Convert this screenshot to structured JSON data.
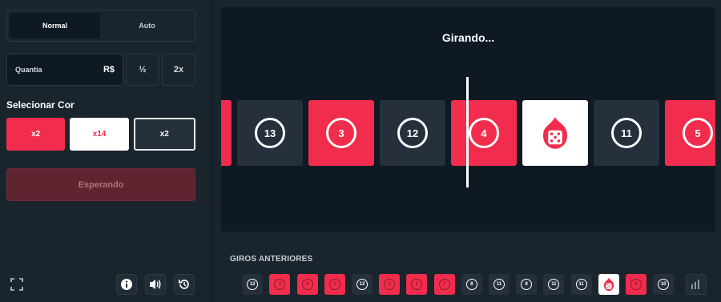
{
  "mode": {
    "tabs": [
      "Normal",
      "Auto"
    ],
    "active": "Normal"
  },
  "bet": {
    "amount_label": "Quantia",
    "currency": "R$",
    "half_label": "½",
    "double_label": "2x"
  },
  "color_select": {
    "title": "Selecionar Cor",
    "options": [
      {
        "label": "x2",
        "color": "red"
      },
      {
        "label": "x14",
        "color": "white"
      },
      {
        "label": "x2",
        "color": "black"
      }
    ],
    "selected": "black"
  },
  "action_button": "Esperando",
  "stage": {
    "status": "Girando...",
    "tiles": [
      {
        "color": "red",
        "number": ""
      },
      {
        "color": "black",
        "number": "13"
      },
      {
        "color": "red",
        "number": "3"
      },
      {
        "color": "black",
        "number": "12"
      },
      {
        "color": "red",
        "number": "4"
      },
      {
        "color": "white",
        "number": "",
        "icon": "dice-icon"
      },
      {
        "color": "black",
        "number": "11"
      },
      {
        "color": "red",
        "number": "5"
      }
    ]
  },
  "history": {
    "title": "GIROS ANTERIORES",
    "items": [
      {
        "color": "red",
        "number": ""
      },
      {
        "color": "black",
        "number": "12"
      },
      {
        "color": "red",
        "number": "4"
      },
      {
        "color": "red",
        "number": "4"
      },
      {
        "color": "red",
        "number": "1"
      },
      {
        "color": "black",
        "number": "12"
      },
      {
        "color": "red",
        "number": "2"
      },
      {
        "color": "red",
        "number": "1"
      },
      {
        "color": "red",
        "number": "7"
      },
      {
        "color": "black",
        "number": "8"
      },
      {
        "color": "black",
        "number": "11"
      },
      {
        "color": "black",
        "number": "8"
      },
      {
        "color": "black",
        "number": "11"
      },
      {
        "color": "black",
        "number": "11"
      },
      {
        "color": "white",
        "number": "",
        "icon": "dice-icon"
      },
      {
        "color": "red",
        "number": "3"
      },
      {
        "color": "black",
        "number": "10"
      }
    ]
  },
  "footer_icons": [
    "fullscreen-icon",
    "info-icon",
    "sound-icon",
    "history-icon"
  ],
  "colors": {
    "red": "#f12c4c",
    "black": "#262f3c",
    "white": "#ffffff",
    "background": "#1a242d",
    "stage": "#0f1923"
  }
}
